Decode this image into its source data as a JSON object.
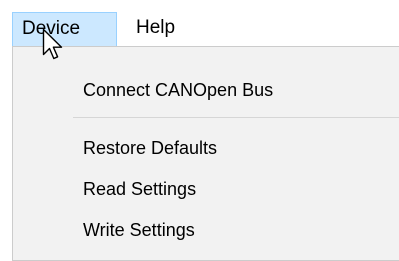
{
  "menubar": {
    "items": [
      {
        "label": "Device"
      },
      {
        "label": "Help"
      }
    ]
  },
  "device_menu": {
    "items": [
      {
        "label": "Connect CANOpen Bus"
      },
      {
        "label": "Restore Defaults"
      },
      {
        "label": "Read Settings"
      },
      {
        "label": "Write Settings"
      }
    ]
  },
  "icons": {
    "cursor": "mouse-pointer-icon"
  }
}
